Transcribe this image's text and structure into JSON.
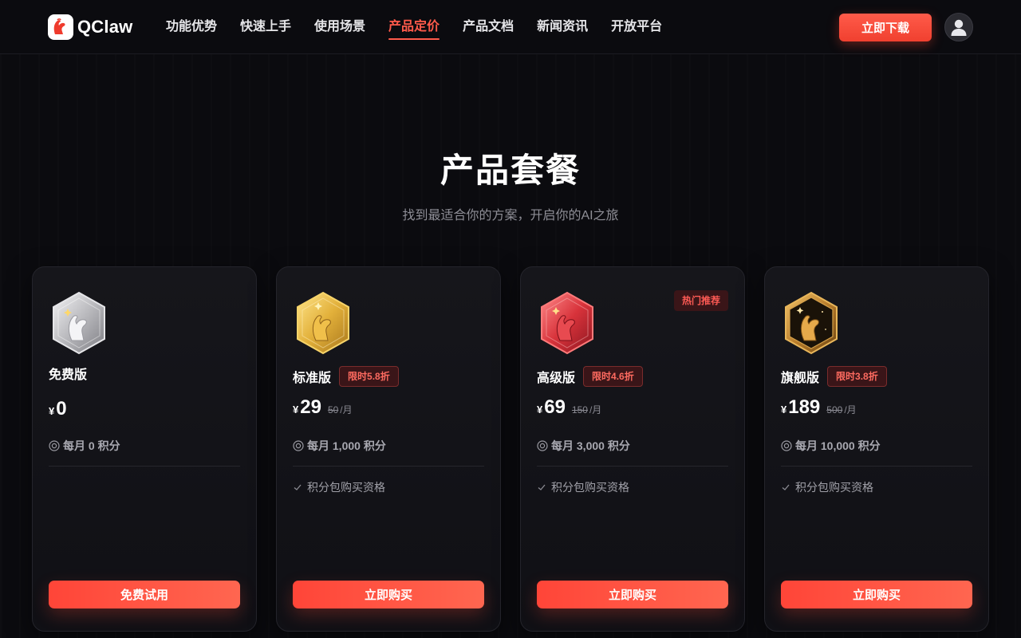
{
  "header": {
    "logo_text": "QClaw",
    "nav": [
      {
        "label": "功能优势",
        "active": false
      },
      {
        "label": "快速上手",
        "active": false
      },
      {
        "label": "使用场景",
        "active": false
      },
      {
        "label": "产品定价",
        "active": true
      },
      {
        "label": "产品文档",
        "active": false
      },
      {
        "label": "新闻资讯",
        "active": false
      },
      {
        "label": "开放平台",
        "active": false
      }
    ],
    "download_label": "立即下载"
  },
  "hero": {
    "title": "产品套餐",
    "subtitle": "找到最适合你的方案，开启你的AI之旅"
  },
  "colors": {
    "accent": "#ff4d3d",
    "silver": "#c9c9cc",
    "gold": "#e0b43a",
    "red": "#d8333b",
    "bronze": "#b97d2c"
  },
  "plans": [
    {
      "badge_icon": "silver-claw-badge-icon",
      "name": "免费版",
      "discount": "",
      "currency": "¥",
      "price": "0",
      "original_price": "",
      "per": "",
      "points_icon": "points-coin-icon",
      "points": "每月 0 积分",
      "feature": "",
      "hot": "",
      "button": "免费试用"
    },
    {
      "badge_icon": "gold-claw-badge-icon",
      "name": "标准版",
      "discount": "限时5.8折",
      "currency": "¥",
      "price": "29",
      "original_price": "50",
      "per": "/月",
      "points_icon": "points-coin-icon",
      "points": "每月 1,000 积分",
      "feature": "积分包购买资格",
      "hot": "",
      "button": "立即购买"
    },
    {
      "badge_icon": "red-claw-badge-icon",
      "name": "高级版",
      "discount": "限时4.6折",
      "currency": "¥",
      "price": "69",
      "original_price": "150",
      "per": "/月",
      "points_icon": "points-coin-icon",
      "points": "每月 3,000 积分",
      "feature": "积分包购买资格",
      "hot": "热门推荐",
      "button": "立即购买"
    },
    {
      "badge_icon": "bronze-claw-badge-icon",
      "name": "旗舰版",
      "discount": "限时3.8折",
      "currency": "¥",
      "price": "189",
      "original_price": "500",
      "per": "/月",
      "points_icon": "points-coin-icon",
      "points": "每月 10,000 积分",
      "feature": "积分包购买资格",
      "hot": "",
      "button": "立即购买"
    }
  ]
}
